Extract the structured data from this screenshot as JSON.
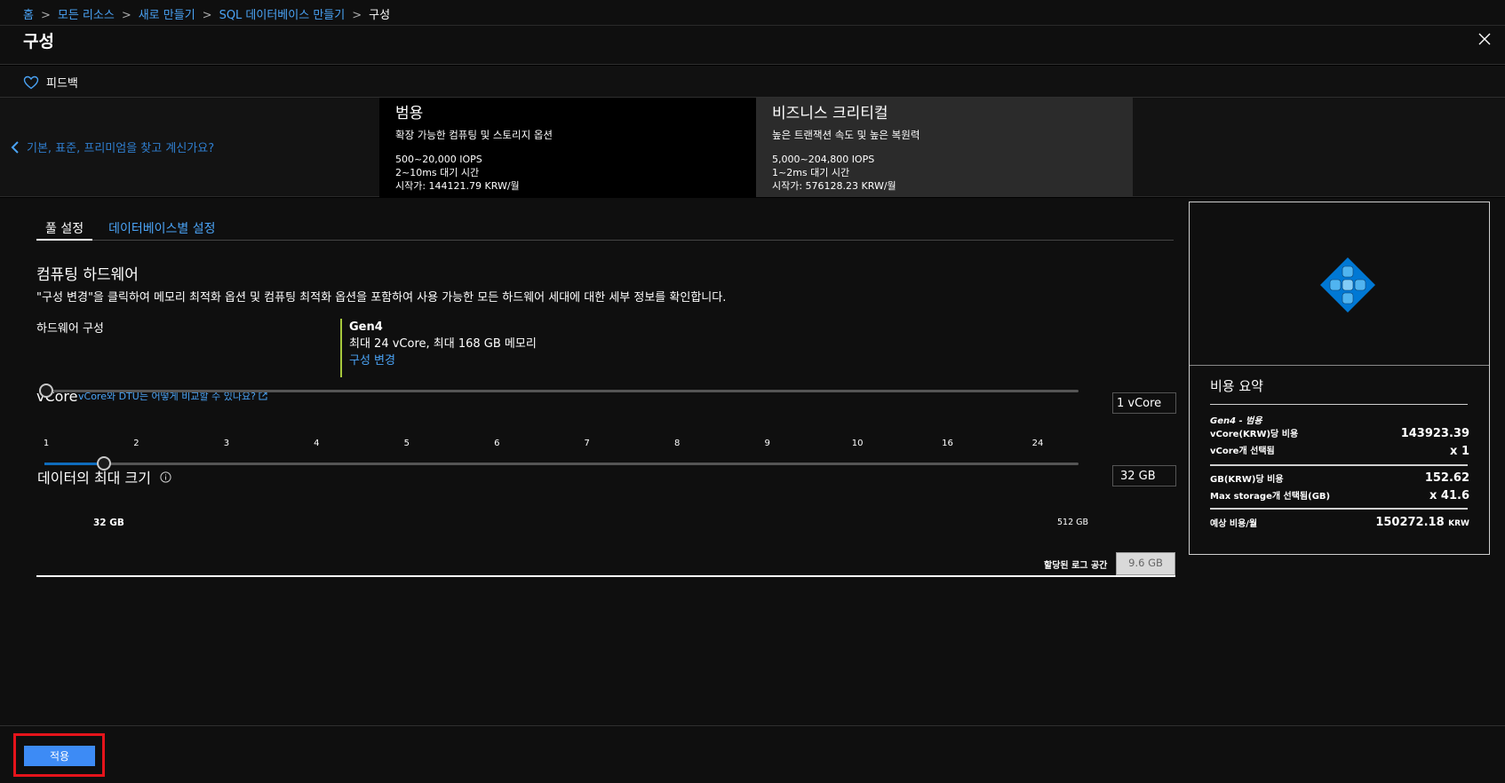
{
  "breadcrumb": {
    "items": [
      "홈",
      "모든 리소스",
      "새로 만들기",
      "SQL 데이터베이스 만들기"
    ],
    "current": "구성",
    "separator": ">"
  },
  "title": "구성",
  "command_bar": {
    "feedback_label": "피드백"
  },
  "tiers": {
    "back_label": "기본, 표준, 프리미엄을 찾고 계신가요?",
    "general_purpose": {
      "name": "범용",
      "desc": "확장 가능한 컴퓨팅 및 스토리지 옵션",
      "iops": "500~20,000 IOPS",
      "latency": "2~10ms 대기 시간",
      "price": "시작가: 144121.79 KRW/월"
    },
    "business_critical": {
      "name": "비즈니스 크리티컬",
      "desc": "높은 트랜잭션 속도 및 높은 복원력",
      "iops": "5,000~204,800 IOPS",
      "latency": "1~2ms 대기 시간",
      "price": "시작가: 576128.23 KRW/월"
    }
  },
  "tabs": {
    "pool": "풀 설정",
    "per_db": "데이터베이스별 설정"
  },
  "compute": {
    "title": "컴퓨팅 하드웨어",
    "desc": "\"구성 변경\"을 클릭하여 메모리 최적화 옵션 및 컴퓨팅 최적화 옵션을 포함하여 사용 가능한 모든 하드웨어 세대에 대한 세부 정보를 확인합니다.",
    "hw_label": "하드웨어 구성",
    "hw_gen": "Gen4",
    "hw_desc": "최대 24 vCore, 최대 168 GB 메모리",
    "hw_change": "구성 변경"
  },
  "vcore": {
    "label": "vCore",
    "link": "vCore와 DTU는 어떻게 비교할 수 있나요?",
    "ticks": [
      "1",
      "2",
      "3",
      "4",
      "5",
      "6",
      "7",
      "8",
      "9",
      "10",
      "16",
      "24"
    ],
    "selected_index": 0,
    "value_text": "1 vCore"
  },
  "max_size": {
    "label": "데이터의 최대 크기",
    "min_label": "32 GB",
    "max_label": "512 GB",
    "value_text": "32 GB",
    "log_label": "할당된 로그 공간",
    "log_value": "9.6 GB"
  },
  "summary": {
    "title": "비용 요약",
    "gen_line": "Gen4 - 범용",
    "vcore_cost_label": "vCore(KRW)당 비용",
    "vcore_cost_value": "143923.39",
    "vcore_sel_label": "vCore개 선택됨",
    "vcore_sel_value": "x 1",
    "gb_cost_label": "GB(KRW)당 비용",
    "gb_cost_value": "152.62",
    "storage_sel_label": "Max storage개 선택됨(GB)",
    "storage_sel_value": "x 41.6",
    "monthly_label": "예상 비용/월",
    "monthly_value": "150272.18",
    "monthly_unit": "KRW"
  },
  "footer": {
    "apply_label": "적용"
  },
  "colors": {
    "accent": "#4aa3f5",
    "apply": "#3d8bf5",
    "highlight": "#e5141b",
    "hw_bar": "#a6c83c",
    "icon": "#0078d4"
  }
}
